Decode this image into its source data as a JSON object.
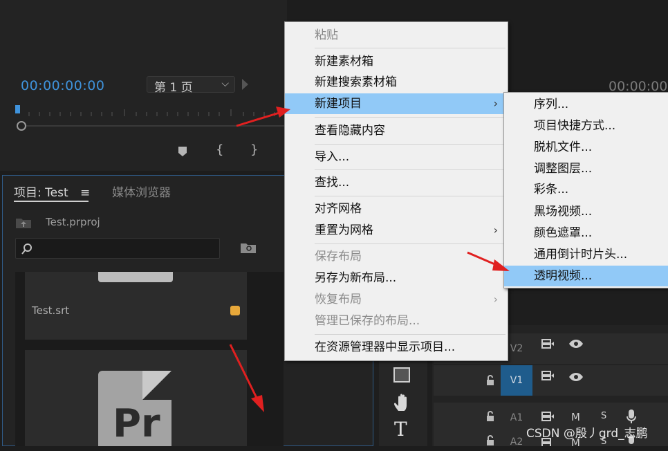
{
  "source_monitor": {
    "timecode": "00:00:00:00",
    "page_select": "第 1 页"
  },
  "program_monitor": {
    "timecode": "00:00:00"
  },
  "project_panel": {
    "tab_project": "项目: Test",
    "tab_menu_icon": "≡",
    "tab_media_browser": "媒体浏览器",
    "project_file": "Test.prproj",
    "items": [
      {
        "name": "Test.srt",
        "badge_color": "#e8a83a"
      },
      {
        "name": "Pr",
        "icon": "premiere-document-icon"
      }
    ]
  },
  "context_menu": {
    "items": [
      {
        "label": "粘贴",
        "disabled": true
      },
      {
        "label": "新建素材箱"
      },
      {
        "label": "新建搜索素材箱"
      },
      {
        "label": "新建项目",
        "highlighted": true,
        "submenu": "›"
      },
      {
        "label": "查看隐藏内容"
      },
      {
        "label": "导入..."
      },
      {
        "label": "查找..."
      },
      {
        "label": "对齐网格"
      },
      {
        "label": "重置为网格",
        "submenu": "›"
      },
      {
        "label": "保存布局",
        "disabled": true
      },
      {
        "label": "另存为新布局..."
      },
      {
        "label": "恢复布局",
        "disabled": true,
        "submenu": "›"
      },
      {
        "label": "管理已保存的布局...",
        "disabled": true
      },
      {
        "label": "在资源管理器中显示项目..."
      }
    ]
  },
  "submenu": {
    "items": [
      {
        "label": "序列..."
      },
      {
        "label": "项目快捷方式..."
      },
      {
        "label": "脱机文件..."
      },
      {
        "label": "调整图层..."
      },
      {
        "label": "彩条..."
      },
      {
        "label": "黑场视频..."
      },
      {
        "label": "颜色遮罩..."
      },
      {
        "label": "通用倒计时片头..."
      },
      {
        "label": "透明视频...",
        "highlighted": true
      }
    ]
  },
  "timeline": {
    "tracks": [
      {
        "label": "V2",
        "active": false
      },
      {
        "label": "V1",
        "active": true
      },
      {
        "label": "A1",
        "active": false,
        "m": "M",
        "s": "S"
      },
      {
        "label": "A2",
        "active": false,
        "m": "M",
        "s": "S"
      }
    ],
    "tools": [
      "rectangle-tool-icon",
      "hand-tool-icon",
      "type-tool-icon"
    ],
    "type_tool_glyph": "T"
  },
  "watermark": "CSDN @殷丿grd_志鹏",
  "colors": {
    "accent_blue": "#3f93dc",
    "menu_highlight": "#91c9f7",
    "arrow_red": "#e02020"
  }
}
